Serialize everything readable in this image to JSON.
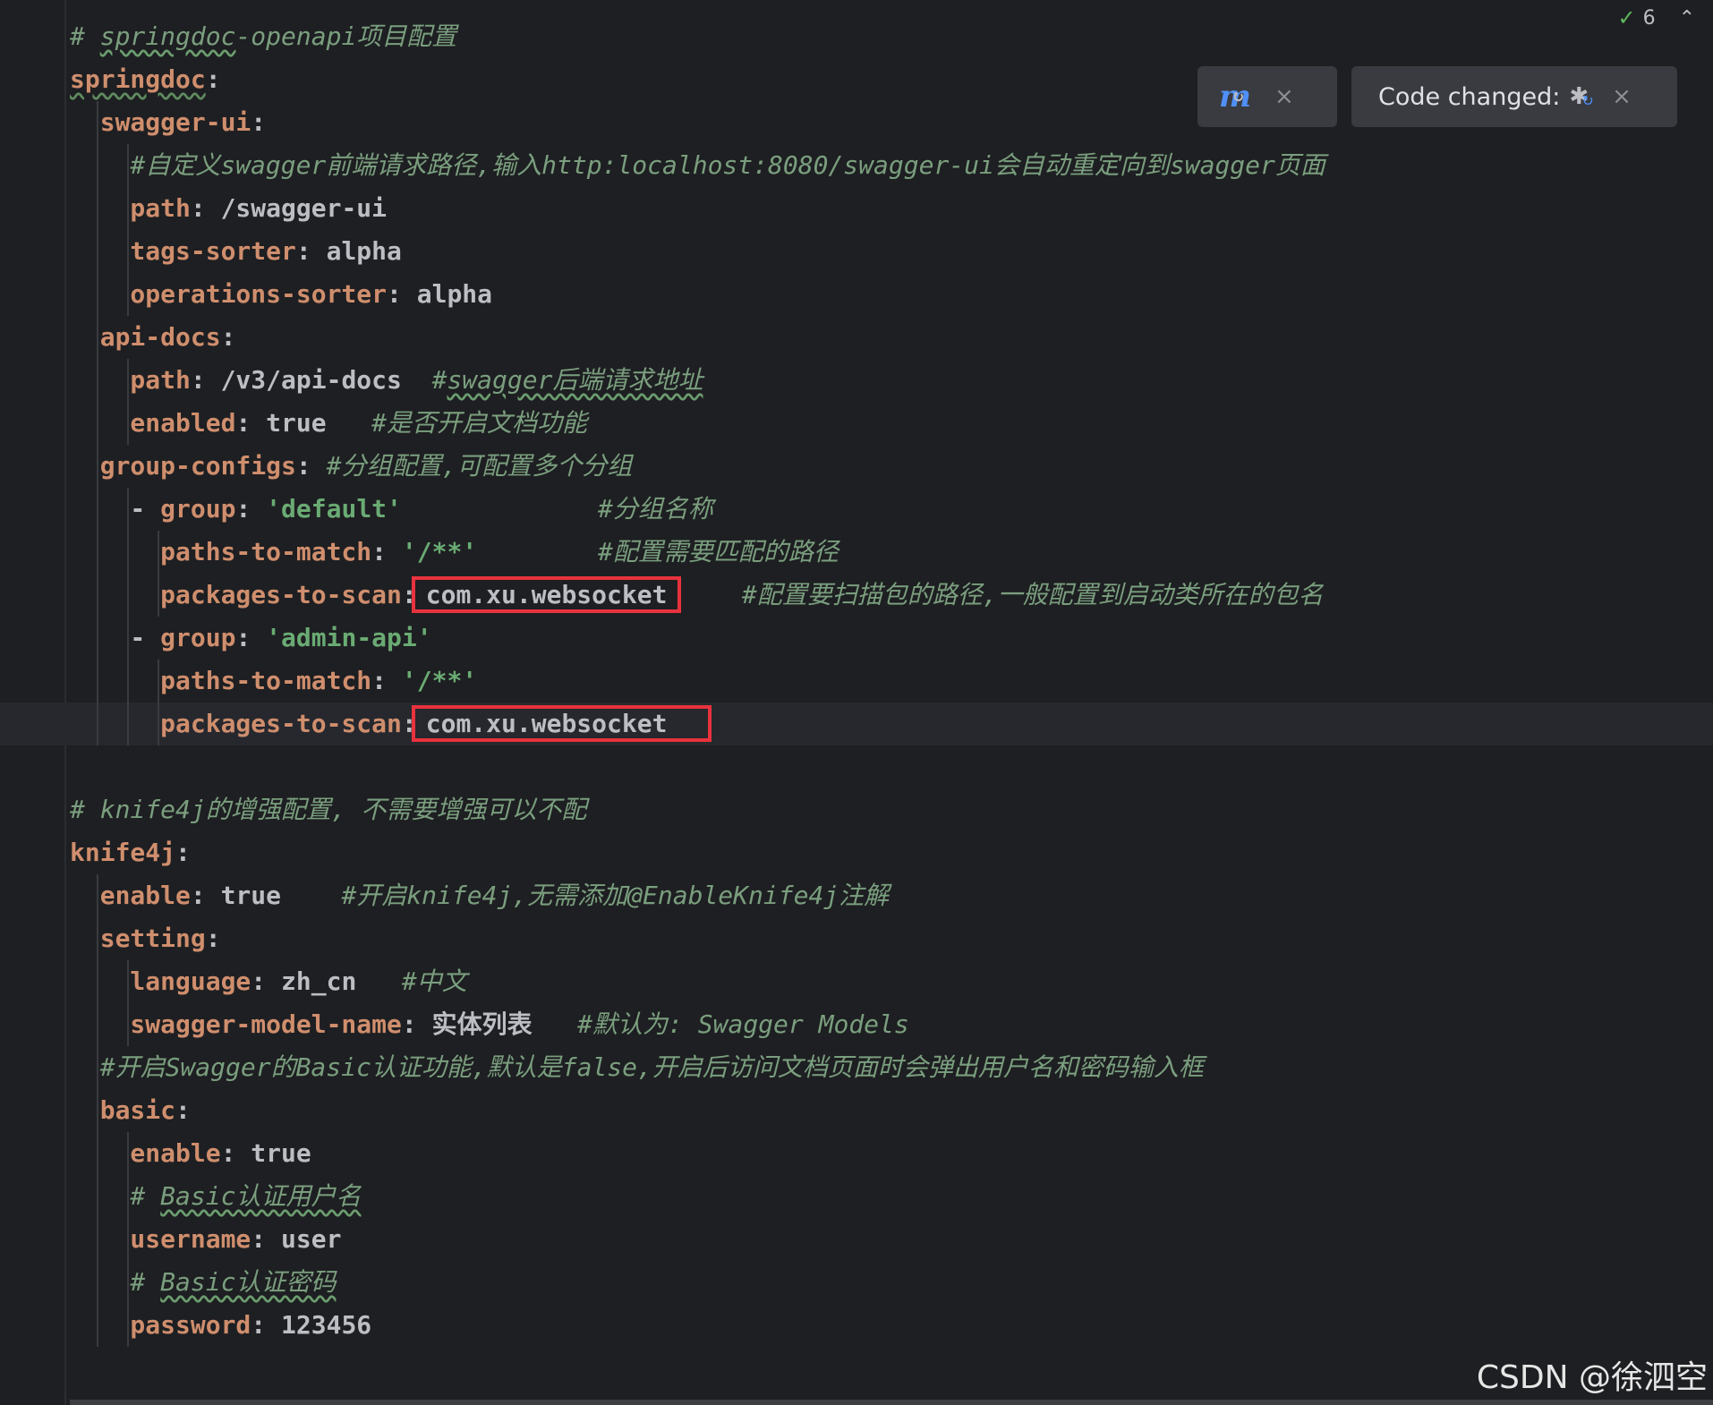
{
  "editor": {
    "lines": [
      {
        "parts": [
          {
            "t": "# ",
            "c": "c"
          },
          {
            "t": "springdoc",
            "c": "c u"
          },
          {
            "t": "-openapi项目配置",
            "c": "c"
          }
        ]
      },
      {
        "parts": [
          {
            "t": "springdoc",
            "c": "k ku"
          },
          {
            "t": ":",
            "c": "p"
          }
        ]
      },
      {
        "parts": [
          {
            "t": "  swagger-ui",
            "c": "k"
          },
          {
            "t": ":",
            "c": "p"
          }
        ]
      },
      {
        "parts": [
          {
            "t": "    #自定义swagger前端请求路径,输入http:localhost:8080/swagger-ui会自动重定向到swagger页面",
            "c": "c"
          }
        ]
      },
      {
        "parts": [
          {
            "t": "    path",
            "c": "k"
          },
          {
            "t": ": ",
            "c": "p"
          },
          {
            "t": "/swagger-ui",
            "c": "v"
          }
        ]
      },
      {
        "parts": [
          {
            "t": "    tags-sorter",
            "c": "k"
          },
          {
            "t": ": ",
            "c": "p"
          },
          {
            "t": "alpha",
            "c": "v"
          }
        ]
      },
      {
        "parts": [
          {
            "t": "    operations-sorter",
            "c": "k"
          },
          {
            "t": ": ",
            "c": "p"
          },
          {
            "t": "alpha",
            "c": "v"
          }
        ]
      },
      {
        "parts": [
          {
            "t": "  api-docs",
            "c": "k"
          },
          {
            "t": ":",
            "c": "p"
          }
        ]
      },
      {
        "parts": [
          {
            "t": "    path",
            "c": "k"
          },
          {
            "t": ": ",
            "c": "p"
          },
          {
            "t": "/v3/api-docs  ",
            "c": "v"
          },
          {
            "t": "#",
            "c": "c"
          },
          {
            "t": "swagger后端请求地址",
            "c": "c u"
          }
        ]
      },
      {
        "parts": [
          {
            "t": "    enabled",
            "c": "k"
          },
          {
            "t": ": ",
            "c": "p"
          },
          {
            "t": "true   ",
            "c": "v"
          },
          {
            "t": "#是否开启文档功能",
            "c": "c"
          }
        ]
      },
      {
        "parts": [
          {
            "t": "  group-configs",
            "c": "k"
          },
          {
            "t": ": ",
            "c": "p"
          },
          {
            "t": "#分组配置,可配置多个分组",
            "c": "c"
          }
        ]
      },
      {
        "parts": [
          {
            "t": "    - ",
            "c": "p"
          },
          {
            "t": "group",
            "c": "k"
          },
          {
            "t": ": ",
            "c": "p"
          },
          {
            "t": "'default'",
            "c": "s"
          },
          {
            "t": "             ",
            "c": "p"
          },
          {
            "t": "#分组名称",
            "c": "c"
          }
        ]
      },
      {
        "parts": [
          {
            "t": "      paths-to-match",
            "c": "k"
          },
          {
            "t": ": ",
            "c": "p"
          },
          {
            "t": "'/**'",
            "c": "s"
          },
          {
            "t": "        ",
            "c": "p"
          },
          {
            "t": "#配置需要匹配的路径",
            "c": "c"
          }
        ]
      },
      {
        "parts": [
          {
            "t": "      packages-to-scan",
            "c": "k"
          },
          {
            "t": ":",
            "c": "p"
          },
          {
            "t": "com.xu.websocket",
            "c": "v box"
          },
          {
            "t": "    ",
            "c": "p"
          },
          {
            "t": "#配置要扫描包的路径,一般配置到启动类所在的包名",
            "c": "c"
          }
        ]
      },
      {
        "parts": [
          {
            "t": "    - ",
            "c": "p"
          },
          {
            "t": "group",
            "c": "k"
          },
          {
            "t": ": ",
            "c": "p"
          },
          {
            "t": "'admin-api'",
            "c": "s"
          }
        ]
      },
      {
        "parts": [
          {
            "t": "      paths-to-match",
            "c": "k"
          },
          {
            "t": ": ",
            "c": "p"
          },
          {
            "t": "'/**'",
            "c": "s"
          }
        ]
      },
      {
        "parts": [
          {
            "t": "      packages-to-scan",
            "c": "k"
          },
          {
            "t": ":",
            "c": "p"
          },
          {
            "t": "com.xu.websocket",
            "c": "v box box-wide"
          }
        ],
        "current": true
      },
      {
        "parts": []
      },
      {
        "parts": [
          {
            "t": "# knife4j的增强配置, 不需要增强可以不配",
            "c": "c"
          }
        ]
      },
      {
        "parts": [
          {
            "t": "knife4j",
            "c": "k"
          },
          {
            "t": ":",
            "c": "p"
          }
        ]
      },
      {
        "parts": [
          {
            "t": "  enable",
            "c": "k"
          },
          {
            "t": ": ",
            "c": "p"
          },
          {
            "t": "true    ",
            "c": "v"
          },
          {
            "t": "#开启knife4j,无需添加@EnableKnife4j注解",
            "c": "c"
          }
        ]
      },
      {
        "parts": [
          {
            "t": "  setting",
            "c": "k"
          },
          {
            "t": ":",
            "c": "p"
          }
        ]
      },
      {
        "parts": [
          {
            "t": "    language",
            "c": "k"
          },
          {
            "t": ": ",
            "c": "p"
          },
          {
            "t": "zh_cn   ",
            "c": "v"
          },
          {
            "t": "#中文",
            "c": "c"
          }
        ]
      },
      {
        "parts": [
          {
            "t": "    swagger-model-name",
            "c": "k"
          },
          {
            "t": ": ",
            "c": "p"
          },
          {
            "t": "实体列表   ",
            "c": "v"
          },
          {
            "t": "#默认为: Swagger Models",
            "c": "c"
          }
        ]
      },
      {
        "parts": [
          {
            "t": "  #开启Swagger的Basic认证功能,默认是false,开启后访问文档页面时会弹出用户名和密码输入框",
            "c": "c"
          }
        ]
      },
      {
        "parts": [
          {
            "t": "  basic",
            "c": "k"
          },
          {
            "t": ":",
            "c": "p"
          }
        ]
      },
      {
        "parts": [
          {
            "t": "    enable",
            "c": "k"
          },
          {
            "t": ": ",
            "c": "p"
          },
          {
            "t": "true",
            "c": "v"
          }
        ]
      },
      {
        "parts": [
          {
            "t": "    # ",
            "c": "c"
          },
          {
            "t": "Basic认证用户名",
            "c": "c u"
          }
        ]
      },
      {
        "parts": [
          {
            "t": "    username",
            "c": "k"
          },
          {
            "t": ": ",
            "c": "p"
          },
          {
            "t": "user",
            "c": "v"
          }
        ]
      },
      {
        "parts": [
          {
            "t": "    # ",
            "c": "c"
          },
          {
            "t": "Basic认证密码",
            "c": "c u"
          }
        ]
      },
      {
        "parts": [
          {
            "t": "    password",
            "c": "k"
          },
          {
            "t": ": ",
            "c": "p"
          },
          {
            "t": "123456",
            "c": "v"
          }
        ]
      }
    ]
  },
  "inspection": {
    "count": "6",
    "icon": "check-icon"
  },
  "maven_popup": {
    "icon": "maven-reload-icon",
    "close": "×"
  },
  "code_changed_popup": {
    "label": "Code changed:",
    "icon": "debug-reload-icon",
    "close": "×"
  },
  "watermark": {
    "text": "CSDN @徐泗空"
  },
  "colors": {
    "key": "#cf8e6d",
    "comment": "#7a9e7e",
    "string": "#6aab73",
    "highlight_box": "#e8323d",
    "background": "#1e1f22"
  }
}
